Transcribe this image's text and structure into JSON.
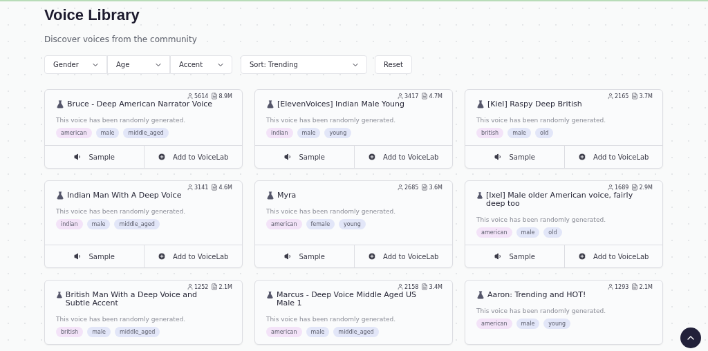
{
  "title": "Voice Library",
  "subtitle": "Discover voices from the community",
  "filters": [
    {
      "label": "Gender"
    },
    {
      "label": "Age"
    },
    {
      "label": "Accent"
    }
  ],
  "sort": {
    "label": "Sort: Trending"
  },
  "reset": "Reset",
  "voices": [
    {
      "name": "Bruce - Deep American Narrator Voice",
      "users": "5614",
      "chars": "8.9M",
      "description": "This voice has been randomly generated.",
      "tags": [
        {
          "label": "american",
          "color": "#f3e3f8"
        },
        {
          "label": "male",
          "color": "#e2e6f8"
        },
        {
          "label": "middle_aged",
          "color": "#e2e6f8"
        }
      ],
      "sample": "Sample",
      "add": "Add to VoiceLab"
    },
    {
      "name": "[ElevenVoices] Indian Male Young",
      "users": "3417",
      "chars": "4.7M",
      "description": "This voice has been randomly generated.",
      "tags": [
        {
          "label": "indian",
          "color": "#f3e3f8"
        },
        {
          "label": "male",
          "color": "#e2e6f8"
        },
        {
          "label": "young",
          "color": "#e2e6f8"
        }
      ],
      "sample": "Sample",
      "add": "Add to VoiceLab"
    },
    {
      "name": "[Kiel] Raspy Deep British",
      "users": "2165",
      "chars": "3.7M",
      "description": "This voice has been randomly generated.",
      "tags": [
        {
          "label": "british",
          "color": "#f3e3f8"
        },
        {
          "label": "male",
          "color": "#e2e6f8"
        },
        {
          "label": "old",
          "color": "#e2e6f8"
        }
      ],
      "sample": "Sample",
      "add": "Add to VoiceLab"
    },
    {
      "name": "Indian Man With A Deep Voice",
      "users": "3141",
      "chars": "4.6M",
      "description": "This voice has been randomly generated.",
      "tags": [
        {
          "label": "indian",
          "color": "#f3e3f8"
        },
        {
          "label": "male",
          "color": "#e2e6f8"
        },
        {
          "label": "middle_aged",
          "color": "#e2e6f8"
        }
      ],
      "sample": "Sample",
      "add": "Add to VoiceLab"
    },
    {
      "name": "Myra",
      "users": "2685",
      "chars": "3.6M",
      "description": "This voice has been randomly generated.",
      "tags": [
        {
          "label": "american",
          "color": "#f3e3f8"
        },
        {
          "label": "female",
          "color": "#e2e6f8"
        },
        {
          "label": "young",
          "color": "#e2e6f8"
        }
      ],
      "sample": "Sample",
      "add": "Add to VoiceLab"
    },
    {
      "name": "[Ixel] Male older American voice, fairly deep too",
      "users": "1689",
      "chars": "2.9M",
      "description": "This voice has been randomly generated.",
      "tags": [
        {
          "label": "american",
          "color": "#f3e3f8"
        },
        {
          "label": "male",
          "color": "#e2e6f8"
        },
        {
          "label": "old",
          "color": "#e2e6f8"
        }
      ],
      "sample": "Sample",
      "add": "Add to VoiceLab"
    },
    {
      "name": "British Man With a Deep Voice and Subtle Accent",
      "users": "1252",
      "chars": "2.1M",
      "description": "This voice has been randomly generated.",
      "tags": [
        {
          "label": "british",
          "color": "#f3e3f8"
        },
        {
          "label": "male",
          "color": "#e2e6f8"
        },
        {
          "label": "middle_aged",
          "color": "#e2e6f8"
        }
      ]
    },
    {
      "name": "Marcus - Deep Voice Middle Aged US Male 1",
      "users": "2158",
      "chars": "3.4M",
      "description": "This voice has been randomly generated.",
      "tags": [
        {
          "label": "american",
          "color": "#f3e3f8"
        },
        {
          "label": "male",
          "color": "#e2e6f8"
        },
        {
          "label": "middle_aged",
          "color": "#e2e6f8"
        }
      ]
    },
    {
      "name": "Aaron: Trending and HOT!",
      "users": "1293",
      "chars": "2.1M",
      "description": "This voice has been randomly generated.",
      "tags": [
        {
          "label": "american",
          "color": "#f3e3f8"
        },
        {
          "label": "male",
          "color": "#e2e6f8"
        },
        {
          "label": "young",
          "color": "#e2e6f8"
        }
      ]
    }
  ]
}
